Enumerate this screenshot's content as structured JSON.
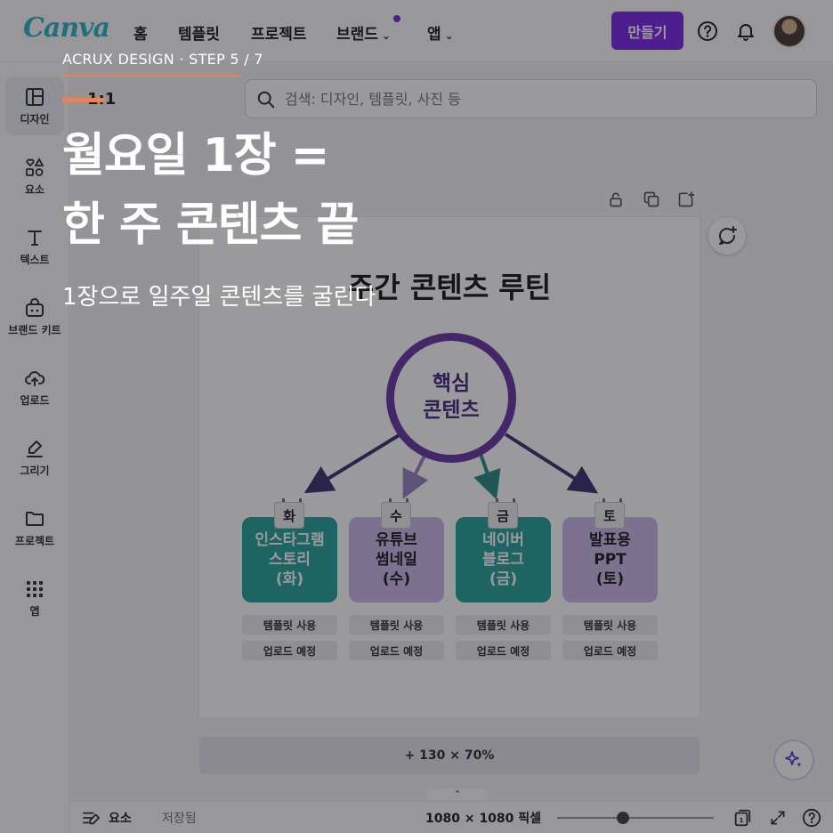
{
  "topbar": {
    "logo": "Canva",
    "nav": [
      {
        "label": "홈",
        "chevron": false
      },
      {
        "label": "템플릿",
        "chevron": false
      },
      {
        "label": "프로젝트",
        "chevron": false
      },
      {
        "label": "브랜드",
        "chevron": true,
        "dot": true
      },
      {
        "label": "앱",
        "chevron": true
      }
    ],
    "create_label": "만들기",
    "icons": [
      "help-icon",
      "bell-icon",
      "avatar"
    ]
  },
  "sidebar": {
    "items": [
      {
        "label": "디자인",
        "icon": "design-icon",
        "active": true
      },
      {
        "label": "요소",
        "icon": "elements-icon"
      },
      {
        "label": "텍스트",
        "icon": "text-icon"
      },
      {
        "label": "브랜드 키트",
        "icon": "brand-kit-icon"
      },
      {
        "label": "업로드",
        "icon": "upload-icon"
      },
      {
        "label": "그리기",
        "icon": "draw-icon"
      },
      {
        "label": "프로젝트",
        "icon": "folder-icon"
      },
      {
        "label": "앱",
        "icon": "apps-grid-icon"
      }
    ]
  },
  "editor": {
    "size_label": "1:1",
    "search_placeholder": "검색: 디자인, 템플릿, 사진 등",
    "add_page_label": "+ 130 × 70%"
  },
  "design": {
    "title": "주간 콘텐츠 루틴",
    "core_lines": [
      "핵심",
      "콘텐츠"
    ],
    "days": [
      {
        "tab": "화",
        "lines": [
          "인스타그램",
          "스토리",
          "(화)"
        ],
        "style": "teal",
        "chip1": "템플릿 사용",
        "chip2": "업로드 예정"
      },
      {
        "tab": "수",
        "lines": [
          "유튜브",
          "썸네일",
          "(수)"
        ],
        "style": "lav",
        "chip1": "템플릿 사용",
        "chip2": "업로드 예정"
      },
      {
        "tab": "금",
        "lines": [
          "네이버",
          "블로그",
          "(금)"
        ],
        "style": "teal",
        "chip1": "템플릿 사용",
        "chip2": "업로드 예정"
      },
      {
        "tab": "토",
        "lines": [
          "발표용",
          "PPT",
          "(토)"
        ],
        "style": "lav",
        "chip1": "템플릿 사용",
        "chip2": "업로드 예정"
      }
    ],
    "colors": {
      "teal": "#2aa39a",
      "lavender": "#cdb9e8",
      "purple": "#6c3aa6"
    }
  },
  "bottombar": {
    "notes_label": "요소",
    "saved_label": "저장됨",
    "size_px": "1080 × 1080 픽셀",
    "page_count": "1",
    "zoom_fraction": 0.42
  },
  "overlay": {
    "step": "ACRUX DESIGN  ·  STEP 5 / 7",
    "headline1": "월요일 1장 =",
    "headline2": "한 주 콘텐츠 끝",
    "subline": "1장으로 일주일 콘텐츠를 굴린다"
  }
}
